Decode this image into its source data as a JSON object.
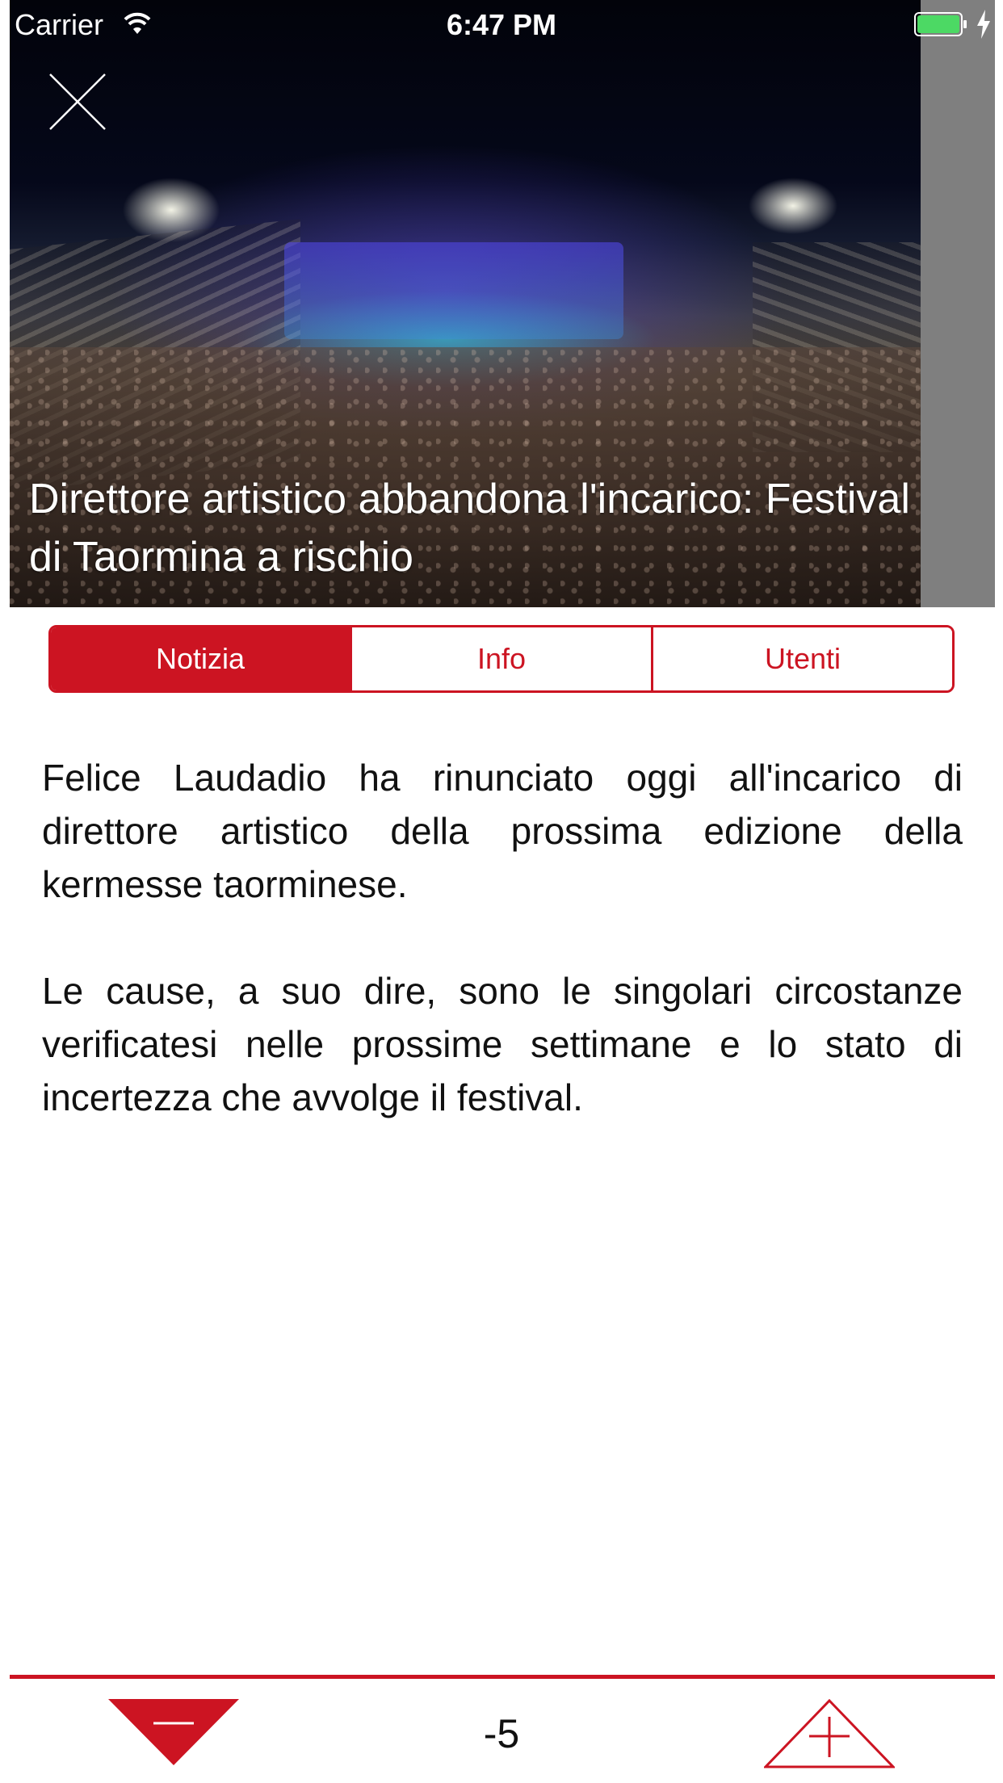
{
  "status_bar": {
    "carrier": "Carrier",
    "time": "6:47 PM",
    "wifi_icon": "wifi-icon",
    "battery_icon": "battery-icon",
    "charging_icon": "lightning-bolt-icon"
  },
  "header": {
    "close_icon": "close-icon",
    "title": "Direttore artistico abbandona l'incarico: Festival di Taormina a rischio",
    "image_description": "night-theatre-photo"
  },
  "tabs": [
    {
      "label": "Notizia",
      "active": true
    },
    {
      "label": "Info",
      "active": false
    },
    {
      "label": "Utenti",
      "active": false
    }
  ],
  "article": {
    "paragraphs": [
      "Felice Laudadio ha rinunciato oggi all'incarico di direttore artistico della prossima edizione della kermesse taorminese.",
      "Le cause, a suo dire, sono le singolari circostanze verificatesi nelle prossime settimane e lo stato di incertezza che avvolge il festival."
    ]
  },
  "voting": {
    "down_icon": "minus-triangle-icon",
    "up_icon": "plus-triangle-icon",
    "score": "-5"
  },
  "colors": {
    "accent": "#cc1422",
    "text": "#111111",
    "background": "#ffffff"
  }
}
